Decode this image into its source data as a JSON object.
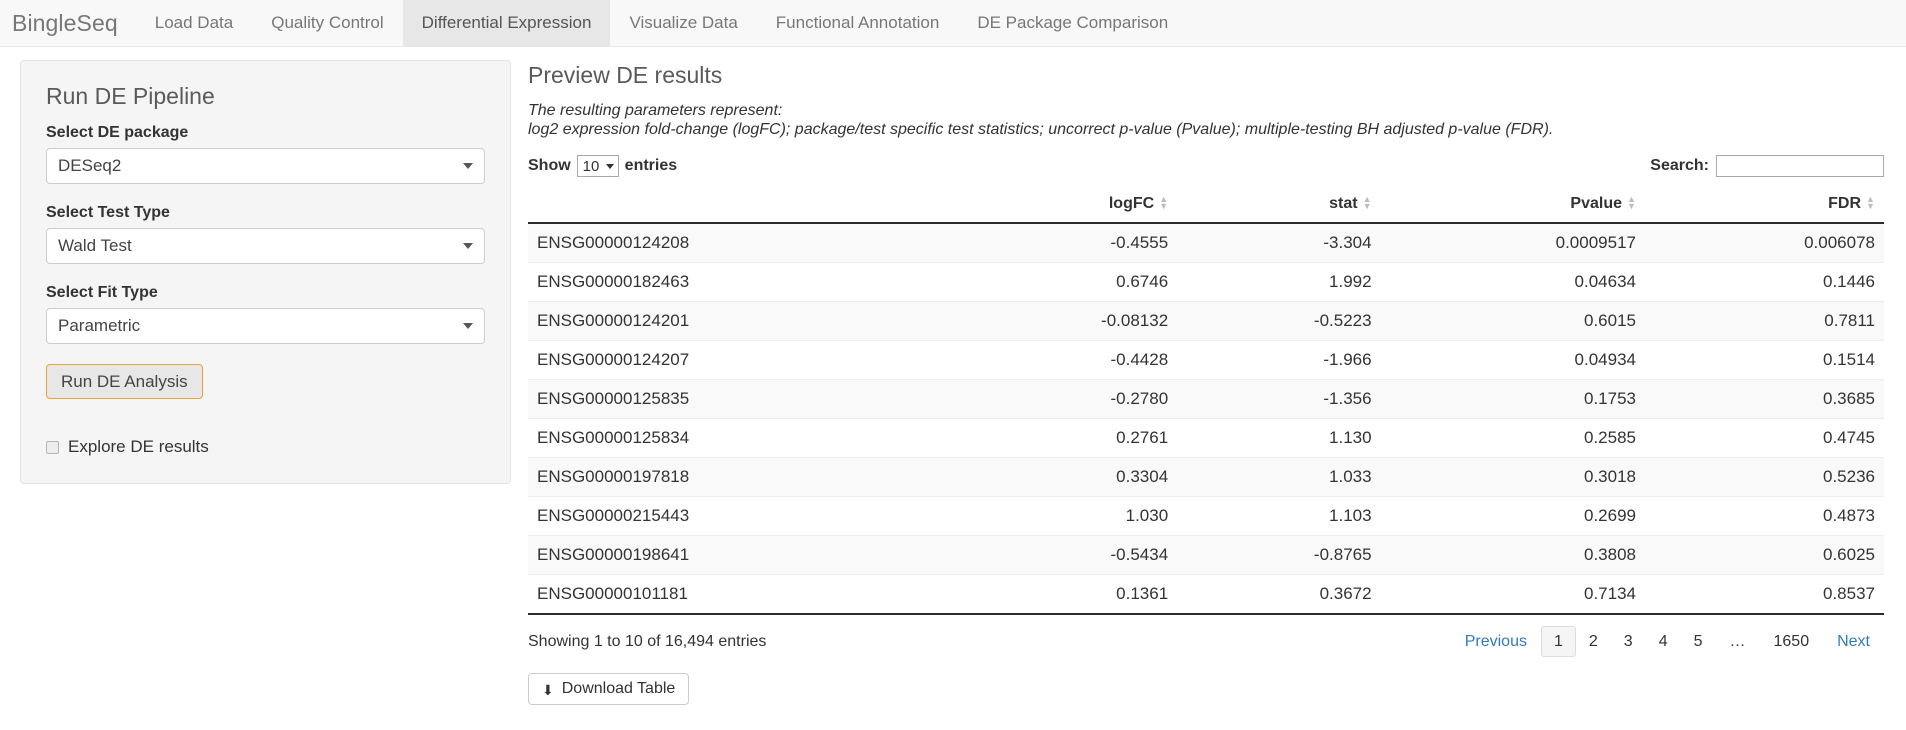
{
  "navbar": {
    "brand": "BingleSeq",
    "items": [
      {
        "label": "Load Data",
        "active": false
      },
      {
        "label": "Quality Control",
        "active": false
      },
      {
        "label": "Differential Expression",
        "active": true
      },
      {
        "label": "Visualize Data",
        "active": false
      },
      {
        "label": "Functional Annotation",
        "active": false
      },
      {
        "label": "DE Package Comparison",
        "active": false
      }
    ]
  },
  "sidebar": {
    "title": "Run DE Pipeline",
    "fields": [
      {
        "label": "Select DE package",
        "value": "DESeq2"
      },
      {
        "label": "Select Test Type",
        "value": "Wald Test"
      },
      {
        "label": "Select Fit Type",
        "value": "Parametric"
      }
    ],
    "run_button": "Run DE Analysis",
    "explore_checkbox_label": "Explore DE results",
    "explore_checkbox_checked": false,
    "accent_color": "#e8a33d"
  },
  "main": {
    "title": "Preview DE results",
    "description_line1": "The resulting parameters represent:",
    "description_line2": "log2 expression fold-change (logFC); package/test specific test statistics; uncorrect p-value (Pvalue); multiple-testing BH adjusted p-value (FDR).",
    "controls": {
      "show_label": "Show",
      "entries_label": "entries",
      "page_length": "10",
      "search_label": "Search:",
      "search_value": "",
      "search_placeholder": ""
    },
    "table": {
      "columns": [
        "",
        "logFC",
        "stat",
        "Pvalue",
        "FDR"
      ],
      "rows": [
        {
          "gene": "ENSG00000124208",
          "logFC": "-0.4555",
          "stat": "-3.304",
          "Pvalue": "0.0009517",
          "FDR": "0.006078"
        },
        {
          "gene": "ENSG00000182463",
          "logFC": "0.6746",
          "stat": "1.992",
          "Pvalue": "0.04634",
          "FDR": "0.1446"
        },
        {
          "gene": "ENSG00000124201",
          "logFC": "-0.08132",
          "stat": "-0.5223",
          "Pvalue": "0.6015",
          "FDR": "0.7811"
        },
        {
          "gene": "ENSG00000124207",
          "logFC": "-0.4428",
          "stat": "-1.966",
          "Pvalue": "0.04934",
          "FDR": "0.1514"
        },
        {
          "gene": "ENSG00000125835",
          "logFC": "-0.2780",
          "stat": "-1.356",
          "Pvalue": "0.1753",
          "FDR": "0.3685"
        },
        {
          "gene": "ENSG00000125834",
          "logFC": "0.2761",
          "stat": "1.130",
          "Pvalue": "0.2585",
          "FDR": "0.4745"
        },
        {
          "gene": "ENSG00000197818",
          "logFC": "0.3304",
          "stat": "1.033",
          "Pvalue": "0.3018",
          "FDR": "0.5236"
        },
        {
          "gene": "ENSG00000215443",
          "logFC": "1.030",
          "stat": "1.103",
          "Pvalue": "0.2699",
          "FDR": "0.4873"
        },
        {
          "gene": "ENSG00000198641",
          "logFC": "-0.5434",
          "stat": "-0.8765",
          "Pvalue": "0.3808",
          "FDR": "0.6025"
        },
        {
          "gene": "ENSG00000101181",
          "logFC": "0.1361",
          "stat": "0.3672",
          "Pvalue": "0.7134",
          "FDR": "0.8537"
        }
      ]
    },
    "footer": {
      "info": "Showing 1 to 10 of 16,494 entries",
      "pagination": [
        {
          "label": "Previous",
          "type": "prev"
        },
        {
          "label": "1",
          "type": "current"
        },
        {
          "label": "2",
          "type": "num"
        },
        {
          "label": "3",
          "type": "num"
        },
        {
          "label": "4",
          "type": "num"
        },
        {
          "label": "5",
          "type": "num"
        },
        {
          "label": "…",
          "type": "ellipsis"
        },
        {
          "label": "1650",
          "type": "edge"
        },
        {
          "label": "Next",
          "type": "next"
        }
      ]
    },
    "download_button": {
      "label": "Download Table",
      "icon": "download-icon"
    }
  }
}
